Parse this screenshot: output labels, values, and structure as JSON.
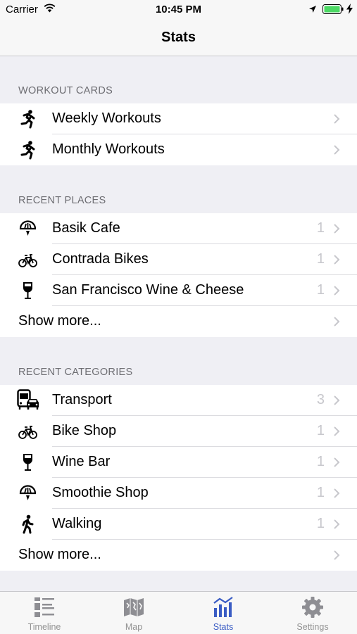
{
  "status": {
    "carrier": "Carrier",
    "time": "10:45 PM"
  },
  "nav": {
    "title": "Stats"
  },
  "workout_cards": {
    "header": "WORKOUT CARDS",
    "items": [
      {
        "label": "Weekly Workouts",
        "icon": "running-icon"
      },
      {
        "label": "Monthly Workouts",
        "icon": "running-icon"
      }
    ]
  },
  "recent_places": {
    "header": "RECENT PLACES",
    "items": [
      {
        "label": "Basik Cafe",
        "count": "1",
        "icon": "smoothie-icon"
      },
      {
        "label": "Contrada Bikes",
        "count": "1",
        "icon": "bicycle-icon"
      },
      {
        "label": "San Francisco Wine & Cheese",
        "count": "1",
        "icon": "wine-glass-icon"
      }
    ],
    "show_more": "Show more..."
  },
  "recent_categories": {
    "header": "RECENT CATEGORIES",
    "items": [
      {
        "label": "Transport",
        "count": "3",
        "icon": "bus-car-icon"
      },
      {
        "label": "Bike Shop",
        "count": "1",
        "icon": "bicycle-icon"
      },
      {
        "label": "Wine Bar",
        "count": "1",
        "icon": "wine-glass-icon"
      },
      {
        "label": "Smoothie Shop",
        "count": "1",
        "icon": "smoothie-icon"
      },
      {
        "label": "Walking",
        "count": "1",
        "icon": "walking-icon"
      }
    ],
    "show_more": "Show more..."
  },
  "tabs": [
    {
      "label": "Timeline",
      "icon": "timeline-icon",
      "active": false
    },
    {
      "label": "Map",
      "icon": "map-icon",
      "active": false
    },
    {
      "label": "Stats",
      "icon": "stats-icon",
      "active": true
    },
    {
      "label": "Settings",
      "icon": "gear-icon",
      "active": false
    }
  ],
  "colors": {
    "accent": "#3a5cc4",
    "background": "#efeff4",
    "secondary_text": "#6d6d72",
    "chevron": "#c7c7cc"
  }
}
